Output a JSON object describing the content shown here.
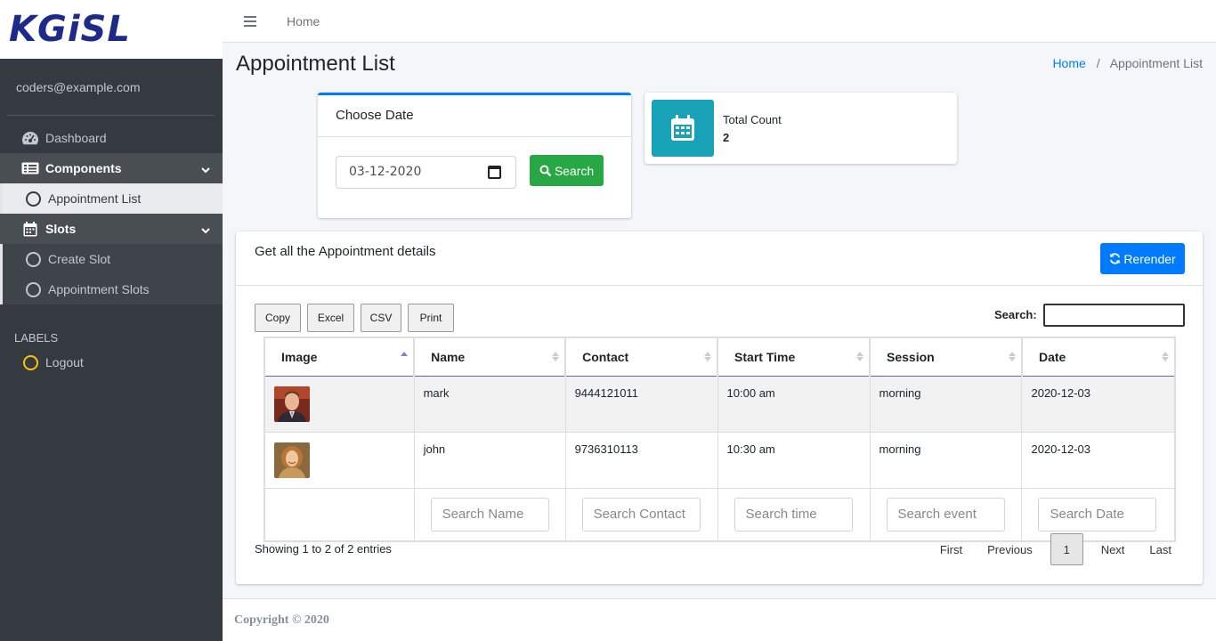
{
  "brand": {
    "logo_text": "KGiSL"
  },
  "user": {
    "email": "coders@example.com"
  },
  "sidebar": {
    "dashboard": "Dashboard",
    "components": "Components",
    "appointment_list": "Appointment List",
    "slots": "Slots",
    "create_slot": "Create Slot",
    "appointment_slots": "Appointment Slots",
    "labels_header": "LABELS",
    "logout": "Logout"
  },
  "topbar": {
    "home": "Home"
  },
  "page": {
    "title": "Appointment List",
    "breadcrumb_home": "Home",
    "breadcrumb_sep": "/",
    "breadcrumb_current": "Appointment List"
  },
  "date_card": {
    "title": "Choose Date",
    "date_value": "03-12-2020",
    "search_label": "Search"
  },
  "count_box": {
    "label": "Total Count",
    "value": "2"
  },
  "main_card": {
    "title": "Get all the Appointment details",
    "render_label": "Rerender"
  },
  "table_tools": {
    "copy": "Copy",
    "excel": "Excel",
    "csv": "CSV",
    "print": "Print",
    "search_label": "Search:"
  },
  "table": {
    "headers": [
      "Image",
      "Name",
      "Contact",
      "Start Time",
      "Session",
      "Date"
    ],
    "rows": [
      {
        "name": "mark",
        "contact": "9444121011",
        "start_time": "10:00 am",
        "session": "morning",
        "date": "2020-12-03"
      },
      {
        "name": "john",
        "contact": "9736310113",
        "start_time": "10:30 am",
        "session": "morning",
        "date": "2020-12-03"
      }
    ],
    "filters": {
      "name": "Search Name",
      "contact": "Search Contact",
      "time": "Search time",
      "event": "Search event",
      "date": "Search Date"
    }
  },
  "pagination": {
    "info": "Showing 1 to 2 of 2 entries",
    "first": "First",
    "previous": "Previous",
    "current": "1",
    "next": "Next",
    "last": "Last"
  },
  "footer": {
    "copyright": "Copyright © 2020"
  },
  "colors": {
    "sidebar_bg": "#343a40",
    "primary": "#007bff",
    "success": "#28a745",
    "info": "#17a2b8",
    "logout_circle": "#ffc107"
  },
  "icons": {
    "menu": "hamburger-icon",
    "dashboard": "tachometer-icon",
    "components": "table-list-icon",
    "slots": "calendar-icon",
    "search": "search-icon",
    "rerender": "sync-icon",
    "count": "calendar-icon"
  }
}
